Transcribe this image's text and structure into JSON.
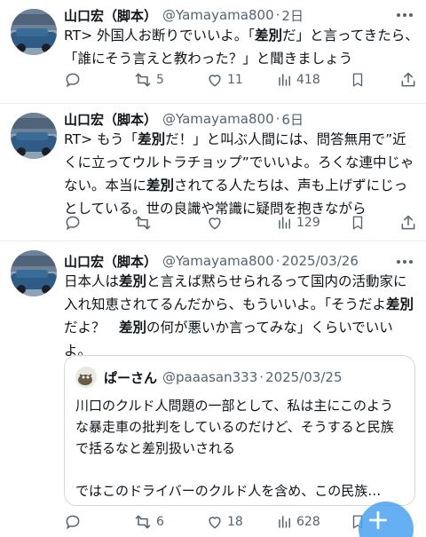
{
  "colors": {
    "text": "#0f1419",
    "muted": "#536471",
    "accent": "#1d9bf0",
    "border": "#e6ecf0"
  },
  "tweets": [
    {
      "author": {
        "name": "山口宏（脚本）",
        "handle": "@Yamayama800",
        "time": "2日"
      },
      "text": [
        [
          "RT> 外国人お断りでいいよ。「",
          false
        ],
        [
          "差別",
          true
        ],
        [
          "だ」と言ってきたら、「誰にそう言えと教わった？」と聞きましょう",
          false
        ]
      ],
      "stats": {
        "replies": "",
        "retweets": "5",
        "likes": "11",
        "views": "418"
      },
      "icons": [
        "reply-icon",
        "retweet-icon",
        "like-icon",
        "views-icon",
        "bookmark-icon",
        "share-icon"
      ]
    },
    {
      "author": {
        "name": "山口宏（脚本）",
        "handle": "@Yamayama800",
        "time": "6日"
      },
      "text": [
        [
          "RT> もう「",
          false
        ],
        [
          "差別",
          true
        ],
        [
          "だ！」と叫ぶ人間には、問答無用で”近くに立ってウルトラチョップ”でいいよ。ろくな連中じゃない。本当に",
          false
        ],
        [
          "差別",
          true
        ],
        [
          "されてる人たちは、声も上げずにじっとしている。世の良識や常識に疑問を抱きながら",
          false
        ]
      ],
      "stats": {
        "replies": "",
        "retweets": "",
        "likes": "",
        "views": "129"
      }
    },
    {
      "author": {
        "name": "山口宏（脚本）",
        "handle": "@Yamayama800",
        "time": "2025/03/26"
      },
      "text": [
        [
          "日本人は",
          false
        ],
        [
          "差別",
          true
        ],
        [
          "と言えば黙らせられるって国内の活動家に入れ知恵されてるんだから、もういいよ。「そうだよ",
          false
        ],
        [
          "差別",
          true
        ],
        [
          "だよ？　",
          false
        ],
        [
          "差別",
          true
        ],
        [
          "の何が悪いか言ってみな」くらいでいいよ。",
          false
        ]
      ],
      "quote": {
        "name": "ぱーさん",
        "handle": "@paaasan333",
        "time": "2025/03/25",
        "text": "川口のクルド人問題の一部として、私は主にこのような暴走車の批判をしているのだけど、そうすると民族で括るなと差別扱いされる",
        "text2": "ではこのドライバーのクルド人を含め、この民族…"
      },
      "stats": {
        "replies": "",
        "retweets": "6",
        "likes": "18",
        "views": "628"
      }
    }
  ],
  "compose_button": {
    "icon": "plus-icon"
  }
}
